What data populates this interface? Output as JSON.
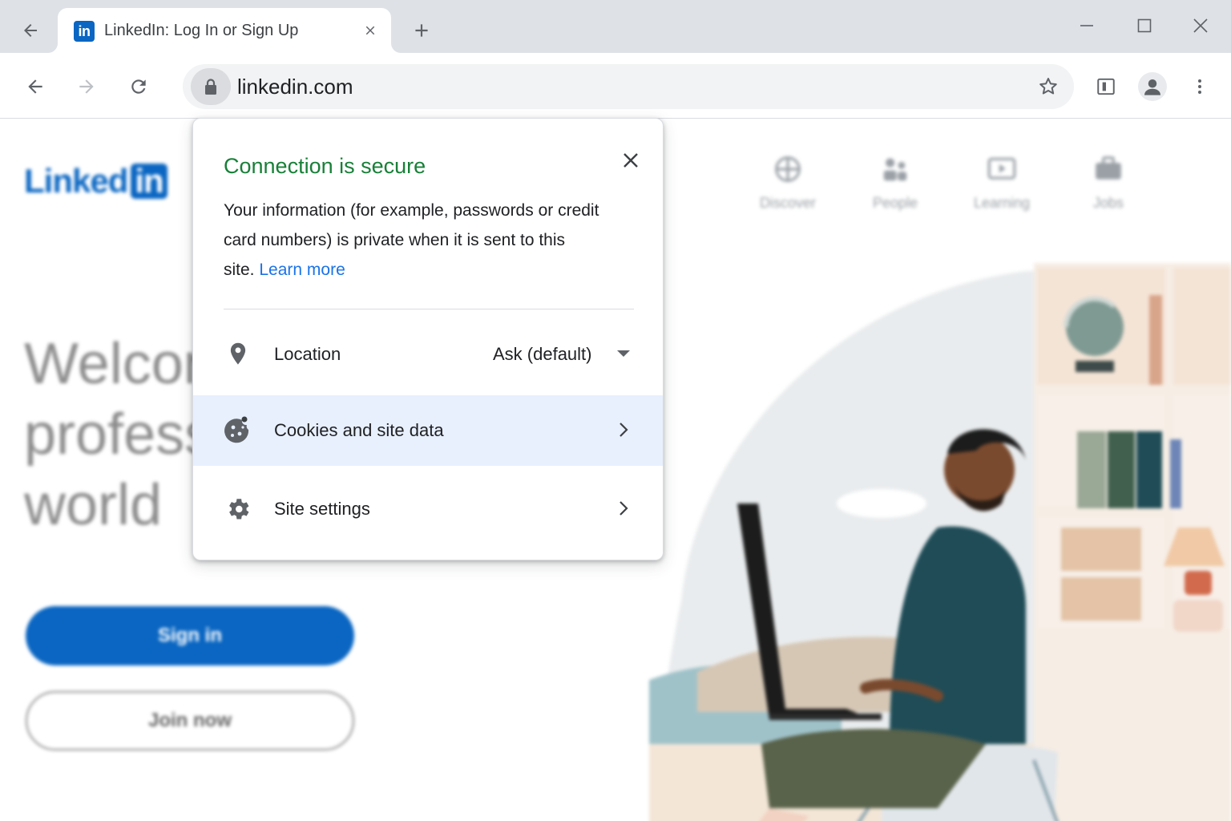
{
  "tab": {
    "favicon_text": "in",
    "title": "LinkedIn: Log In or Sign Up"
  },
  "omnibox": {
    "url": "linkedin.com"
  },
  "page": {
    "logo_text": "Linked",
    "logo_box": "in",
    "hero_lines": [
      "Welcor",
      "profess",
      "world"
    ],
    "signin_label": "Sign in",
    "join_label": "Join now",
    "nav": [
      {
        "label": "Discover",
        "icon": "compass-icon"
      },
      {
        "label": "People",
        "icon": "people-icon"
      },
      {
        "label": "Learning",
        "icon": "learning-icon"
      },
      {
        "label": "Jobs",
        "icon": "briefcase-icon"
      }
    ]
  },
  "popup": {
    "title": "Connection is secure",
    "description": "Your information (for example, passwords or credit card numbers) is private when it is sent to this site.",
    "learn_more": "Learn more",
    "rows": {
      "location": {
        "label": "Location",
        "value": "Ask (default)"
      },
      "cookies": {
        "label": "Cookies and site data"
      },
      "site_settings": {
        "label": "Site settings"
      }
    }
  },
  "colors": {
    "secure_green": "#188038",
    "link_blue": "#1a73e8",
    "linkedin_blue": "#0a66c2",
    "highlight_row": "#e8f0fe",
    "tabstrip": "#dee1e6"
  }
}
